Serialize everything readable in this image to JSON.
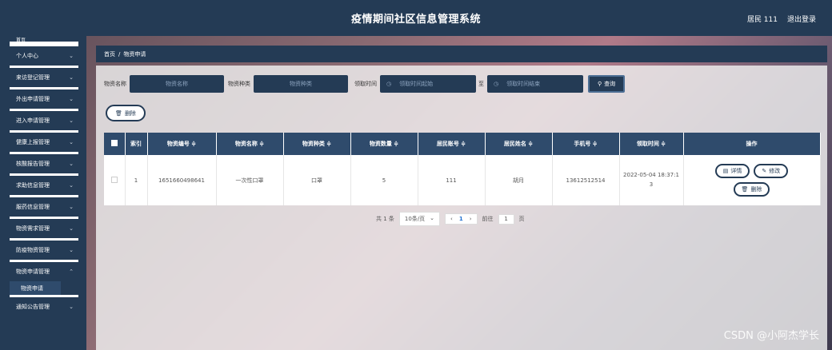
{
  "app": {
    "title": "疫情期间社区信息管理系统",
    "user": "居民 111",
    "logout": "退出登录"
  },
  "sidebar": {
    "first": "首页",
    "items": [
      {
        "label": "个人中心"
      },
      {
        "label": "来访登记管理"
      },
      {
        "label": "外出申请管理"
      },
      {
        "label": "进入申请管理"
      },
      {
        "label": "健康上报管理"
      },
      {
        "label": "核酸报告管理"
      },
      {
        "label": "求助信息管理"
      },
      {
        "label": "服药信息管理"
      },
      {
        "label": "物资需求管理"
      },
      {
        "label": "防疫物资管理"
      },
      {
        "label": "物资申请管理"
      }
    ],
    "sub_item": "物资申请",
    "last": "通知公告管理"
  },
  "breadcrumb": {
    "home": "首页",
    "sep": "/",
    "current": "物资申请"
  },
  "search": {
    "name_label": "物资名称",
    "name_placeholder": "物资名称",
    "type_label": "物资种类",
    "type_placeholder": "物资种类",
    "time_label": "领取时间",
    "start_placeholder": "领取时间起始",
    "to": "至",
    "end_placeholder": "领取时间结束",
    "query": "查询"
  },
  "toolbar": {
    "delete": "删除"
  },
  "table": {
    "headers": [
      "索引",
      "物资编号 ≑",
      "物资名称 ≑",
      "物资种类 ≑",
      "物资数量 ≑",
      "居民账号 ≑",
      "居民姓名 ≑",
      "手机号 ≑",
      "领取时间 ≑",
      "操作"
    ],
    "rows": [
      {
        "index": "1",
        "code": "1651660498641",
        "name": "一次性口罩",
        "type": "口罩",
        "qty": "5",
        "account": "111",
        "resident": "胡月",
        "phone": "13612512514",
        "time": "2022-05-04 18:37:13"
      }
    ],
    "actions": {
      "detail": "详情",
      "edit": "修改",
      "delete": "删除"
    }
  },
  "pager": {
    "total": "共 1 条",
    "size": "10条/页",
    "page": "1",
    "goto": "前往",
    "goto_val": "1",
    "unit": "页"
  },
  "watermark": "CSDN @小阿杰学长",
  "colors": {
    "primary": "#243b55",
    "header": "#2f4b6c"
  }
}
